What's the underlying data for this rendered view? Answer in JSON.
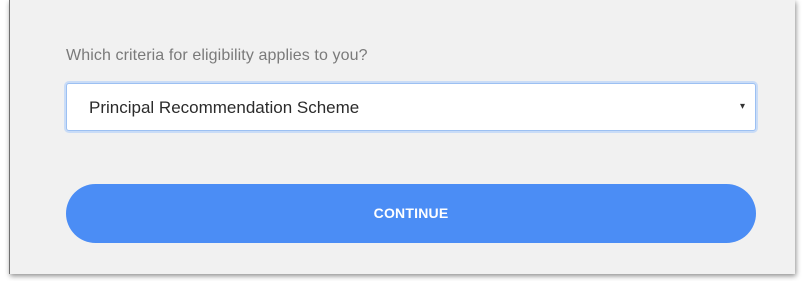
{
  "form": {
    "question": "Which criteria for eligibility applies to you?",
    "eligibility_select": {
      "selected_value": "Principal Recommendation Scheme",
      "caret": "▾"
    },
    "continue_label": "CONTINUE"
  },
  "colors": {
    "panel_background": "#f1f1f1",
    "button_accent": "#4b8df5",
    "select_focus_border": "#9cc0f2"
  },
  "icons": {
    "select_caret": "chevron-down-icon"
  }
}
